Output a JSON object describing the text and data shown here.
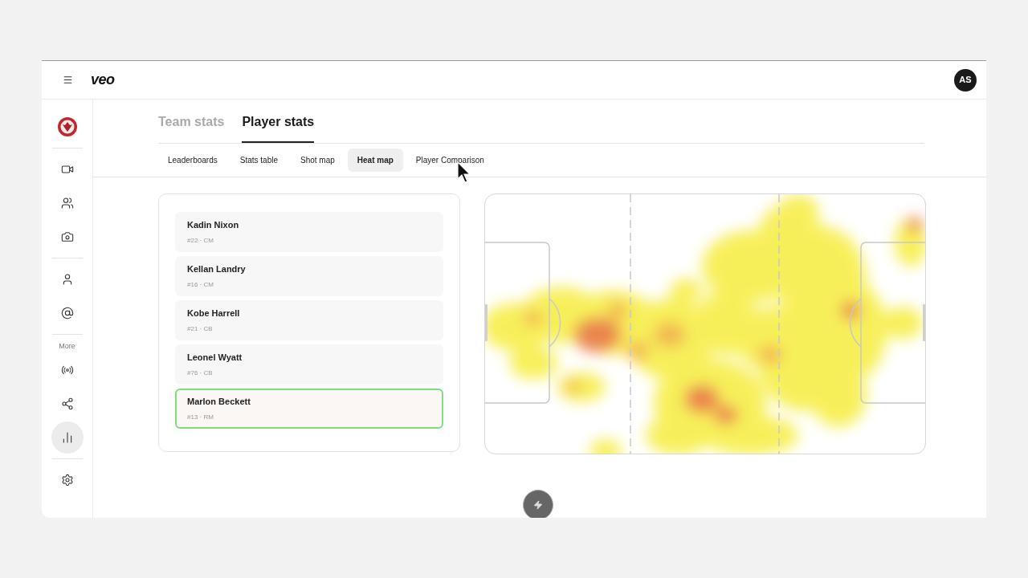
{
  "header": {
    "logo": "veo",
    "avatar": "AS"
  },
  "sidebar": {
    "groups": [
      {
        "items": [
          {
            "kind": "crest",
            "selected": false
          }
        ]
      },
      {
        "items": [
          {
            "kind": "video",
            "selected": false
          },
          {
            "kind": "users",
            "selected": false
          },
          {
            "kind": "camera",
            "selected": false
          }
        ]
      },
      {
        "items": [
          {
            "kind": "user",
            "selected": false
          },
          {
            "kind": "at",
            "selected": false
          }
        ]
      },
      {
        "label": "More",
        "items": [
          {
            "kind": "broadcast",
            "selected": false
          },
          {
            "kind": "share",
            "selected": false
          },
          {
            "kind": "chart",
            "selected": true
          }
        ]
      },
      {
        "items": [
          {
            "kind": "settings",
            "selected": false
          }
        ]
      }
    ]
  },
  "tabs": [
    {
      "label": "Team stats",
      "selected": false
    },
    {
      "label": "Player stats",
      "selected": true
    }
  ],
  "subtabs": [
    {
      "label": "Leaderboards",
      "selected": false
    },
    {
      "label": "Stats table",
      "selected": false
    },
    {
      "label": "Shot map",
      "selected": false
    },
    {
      "label": "Heat map",
      "selected": true
    },
    {
      "label": "Player Comparison",
      "selected": false
    }
  ],
  "players": [
    {
      "name": "Kadin Nixon",
      "detail": "#22 · CM",
      "selected": false
    },
    {
      "name": "Kellan Landry",
      "detail": "#16 · CM",
      "selected": false
    },
    {
      "name": "Kobe Harrell",
      "detail": "#21 · CB",
      "selected": false
    },
    {
      "name": "Leonel Wyatt",
      "detail": "#76 · CB",
      "selected": false
    },
    {
      "name": "Marlon Beckett",
      "detail": "#13 · RM",
      "selected": true
    }
  ]
}
